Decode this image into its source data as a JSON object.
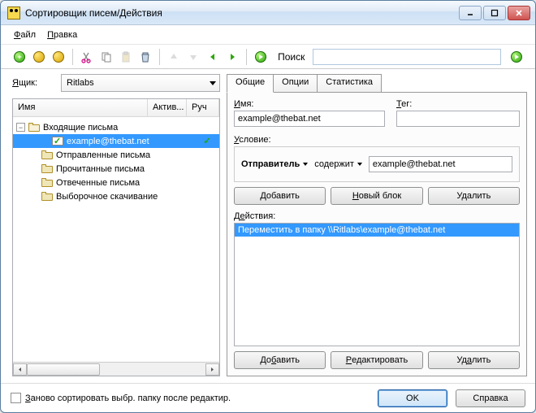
{
  "window": {
    "title": "Сортировщик писем/Действия"
  },
  "menu": {
    "file": "Файл",
    "edit": "Правка"
  },
  "toolbar": {
    "search_label": "Поиск",
    "search_value": ""
  },
  "mailbox": {
    "label": "Ящик:",
    "selected": "Ritlabs"
  },
  "tree": {
    "headers": {
      "name": "Имя",
      "active": "Актив...",
      "manual": "Руч"
    },
    "nodes": {
      "inbox": "Входящие письма",
      "rule": "example@thebat.net",
      "sent": "Отправленные письма",
      "read": "Прочитанные письма",
      "replied": "Отвеченные письма",
      "selective": "Выборочное скачивание"
    }
  },
  "tabs": {
    "general": "Общие",
    "options": "Опции",
    "stats": "Статистика"
  },
  "fields": {
    "name_label": "Имя:",
    "name_value": "example@thebat.net",
    "tag_label": "Тег:",
    "tag_value": "",
    "condition_label": "Условие:"
  },
  "condition": {
    "sender": "Отправитель",
    "contains": "содержит",
    "value": "example@thebat.net"
  },
  "buttons": {
    "add": "Добавить",
    "new_block": "Новый блок",
    "delete": "Удалить",
    "edit": "Редактировать",
    "ok": "OK",
    "help": "Справка"
  },
  "actions": {
    "label": "Действия:",
    "items": [
      "Переместить в папку \\\\Ritlabs\\example@thebat.net"
    ]
  },
  "bottom": {
    "resort": "Заново сортировать выбр. папку после редактир."
  }
}
